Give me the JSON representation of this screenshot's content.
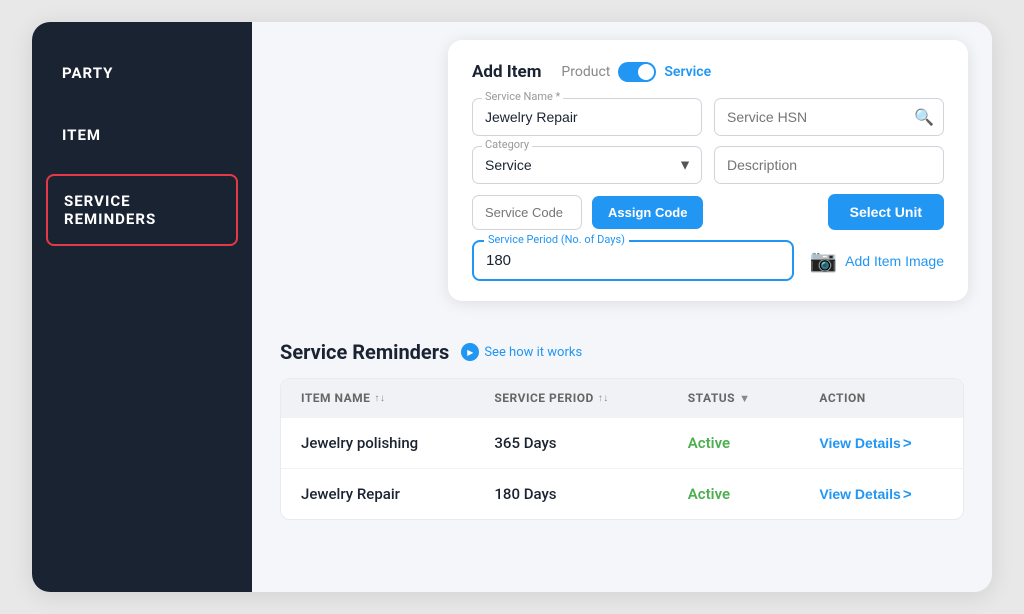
{
  "sidebar": {
    "items": [
      {
        "id": "party",
        "label": "PARTY"
      },
      {
        "id": "item",
        "label": "ITEM"
      },
      {
        "id": "service-reminders",
        "label": "SERVICE REMINDERS",
        "active": true
      }
    ]
  },
  "add_item_card": {
    "title": "Add Item",
    "toggle": {
      "left_label": "Product",
      "right_label": "Service",
      "active": "Service"
    },
    "form": {
      "service_name_label": "Service Name *",
      "service_name_value": "Jewelry Repair",
      "service_hsn_placeholder": "Service HSN",
      "category_label": "Category",
      "category_value": "Service",
      "description_placeholder": "Description",
      "service_code_placeholder": "Service Code",
      "assign_code_label": "Assign Code",
      "select_unit_label": "Select Unit",
      "period_label": "Service Period (No. of Days)",
      "period_value": "180",
      "add_image_label": "Add Item Image"
    }
  },
  "service_reminders": {
    "title": "Service Reminders",
    "see_how_label": "See how it works",
    "table": {
      "columns": [
        {
          "id": "item_name",
          "label": "ITEM NAME",
          "sortable": true
        },
        {
          "id": "service_period",
          "label": "SERVICE PERIOD",
          "sortable": true
        },
        {
          "id": "status",
          "label": "STATUS",
          "filterable": true
        },
        {
          "id": "action",
          "label": "ACTION",
          "sortable": false
        }
      ],
      "rows": [
        {
          "item_name": "Jewelry polishing",
          "service_period": "365 Days",
          "status": "Active",
          "action": "View Details"
        },
        {
          "item_name": "Jewelry Repair",
          "service_period": "180 Days",
          "status": "Active",
          "action": "View Details"
        }
      ]
    }
  }
}
